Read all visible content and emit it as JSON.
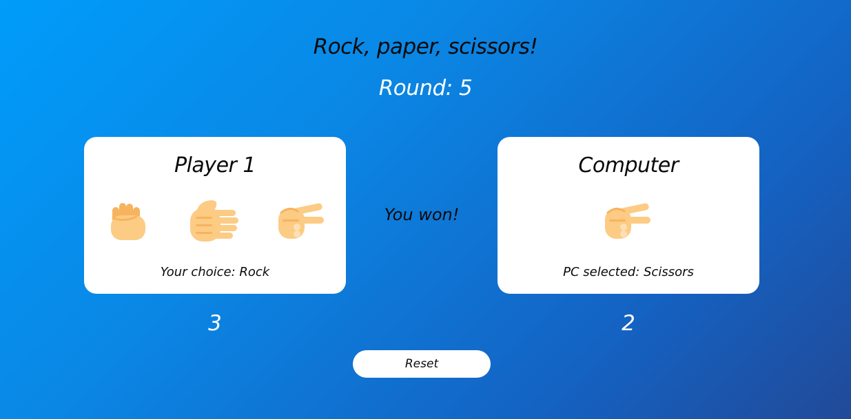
{
  "title": "Rock, paper, scissors!",
  "round": "Round: 5",
  "player": {
    "name": "Player 1",
    "choices": [
      {
        "name": "rock",
        "icon": "fist-icon"
      },
      {
        "name": "paper",
        "icon": "open-hand-icon"
      },
      {
        "name": "scissors",
        "icon": "two-fingers-icon"
      }
    ],
    "choice_text": "Your choice: Rock",
    "score": "3"
  },
  "computer": {
    "name": "Computer",
    "selected_icon": "two-fingers-icon",
    "selected_text": "PC selected: Scissors",
    "score": "2"
  },
  "result": "You won!",
  "reset_label": "Reset",
  "colors": {
    "skin": "#fccb84",
    "skin_dark": "#f7b35e",
    "skin_light": "#fde0b5",
    "background_start": "#009cfa",
    "background_end": "#214a98"
  }
}
